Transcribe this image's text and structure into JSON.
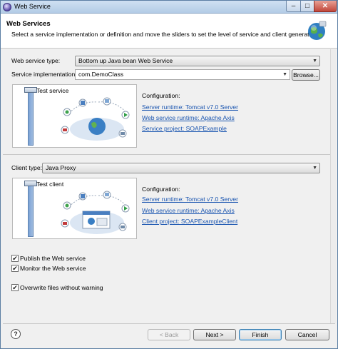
{
  "window": {
    "title": "Web Service"
  },
  "header": {
    "title": "Web Services",
    "description": "Select a service implementation or definition and move the sliders to set the level of service and client generation."
  },
  "service": {
    "type_label": "Web service type:",
    "type_value": "Bottom up Java bean Web Service",
    "impl_label": "Service implementation:",
    "impl_value": "com.DemoClass",
    "browse_label": "Browse...",
    "slider_label": "Test service",
    "config_label": "Configuration:",
    "links": [
      "Server runtime: Tomcat v7.0 Server",
      "Web service runtime: Apache Axis",
      "Service project: SOAPExample"
    ]
  },
  "client": {
    "type_label": "Client type:",
    "type_value": "Java Proxy",
    "slider_label": "Test client",
    "config_label": "Configuration:",
    "links": [
      "Server runtime: Tomcat v7.0 Server",
      "Web service runtime: Apache Axis",
      "Client project: SOAPExampleClient"
    ]
  },
  "options": [
    {
      "label": "Publish the Web service",
      "checked": true
    },
    {
      "label": "Monitor the Web service",
      "checked": true
    },
    {
      "label": "Overwrite files without warning",
      "checked": true
    }
  ],
  "footer": {
    "help_icon": "?",
    "back_label": "< Back",
    "next_label": "Next >",
    "finish_label": "Finish",
    "cancel_label": "Cancel"
  },
  "icons": {
    "title": "eclipse-icon",
    "header": "globe-icon",
    "check": "✔"
  },
  "colors": {
    "link": "#1a55b0",
    "accent": "#4c7fc0"
  }
}
